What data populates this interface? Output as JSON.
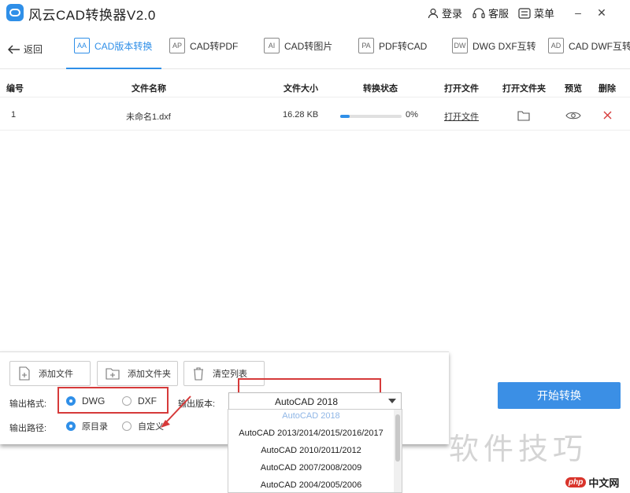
{
  "app": {
    "title": "风云CAD转换器V2.0"
  },
  "titlebar": {
    "login": "登录",
    "service": "客服",
    "menu": "菜单",
    "minimize": "–",
    "close": "✕"
  },
  "nav": {
    "back": "返回",
    "tabs": [
      {
        "label": "CAD版本转换",
        "icon": "AA",
        "active": true
      },
      {
        "label": "CAD转PDF",
        "icon": "AP"
      },
      {
        "label": "CAD转图片",
        "icon": "AI"
      },
      {
        "label": "PDF转CAD",
        "icon": "PA"
      },
      {
        "label": "DWG DXF互转",
        "icon": "DW"
      },
      {
        "label": "CAD DWF互转",
        "icon": "AD"
      }
    ]
  },
  "table": {
    "headers": [
      "编号",
      "文件名称",
      "文件大小",
      "转换状态",
      "打开文件",
      "打开文件夹",
      "预览",
      "删除"
    ],
    "rows": [
      {
        "id": "1",
        "name": "未命名1.dxf",
        "size": "16.28 KB",
        "progress_pct": "0%",
        "progress_value": 0.15,
        "open_file": "打开文件"
      }
    ]
  },
  "actions": {
    "add_file": "添加文件",
    "add_folder": "添加文件夹",
    "clear_list": "清空列表"
  },
  "output": {
    "format_label": "输出格式:",
    "format_options": [
      "DWG",
      "DXF"
    ],
    "format_selected": "DWG",
    "version_label": "输出版本:",
    "version_selected": "AutoCAD 2018",
    "version_options": [
      "AutoCAD 2018",
      "AutoCAD 2013/2014/2015/2016/2017",
      "AutoCAD 2010/2011/2012",
      "AutoCAD 2007/2008/2009",
      "AutoCAD 2004/2005/2006"
    ],
    "path_label": "输出路径:",
    "path_options": [
      "原目录",
      "自定义"
    ],
    "path_selected": "原目录"
  },
  "start_button": "开始转换",
  "watermark": "软件技巧",
  "corner_logo": {
    "php": "php",
    "cn": "中文网"
  },
  "colors": {
    "accent": "#2f8fe8",
    "highlight_box": "#d63a3a",
    "start_button": "#3b8fe5"
  }
}
